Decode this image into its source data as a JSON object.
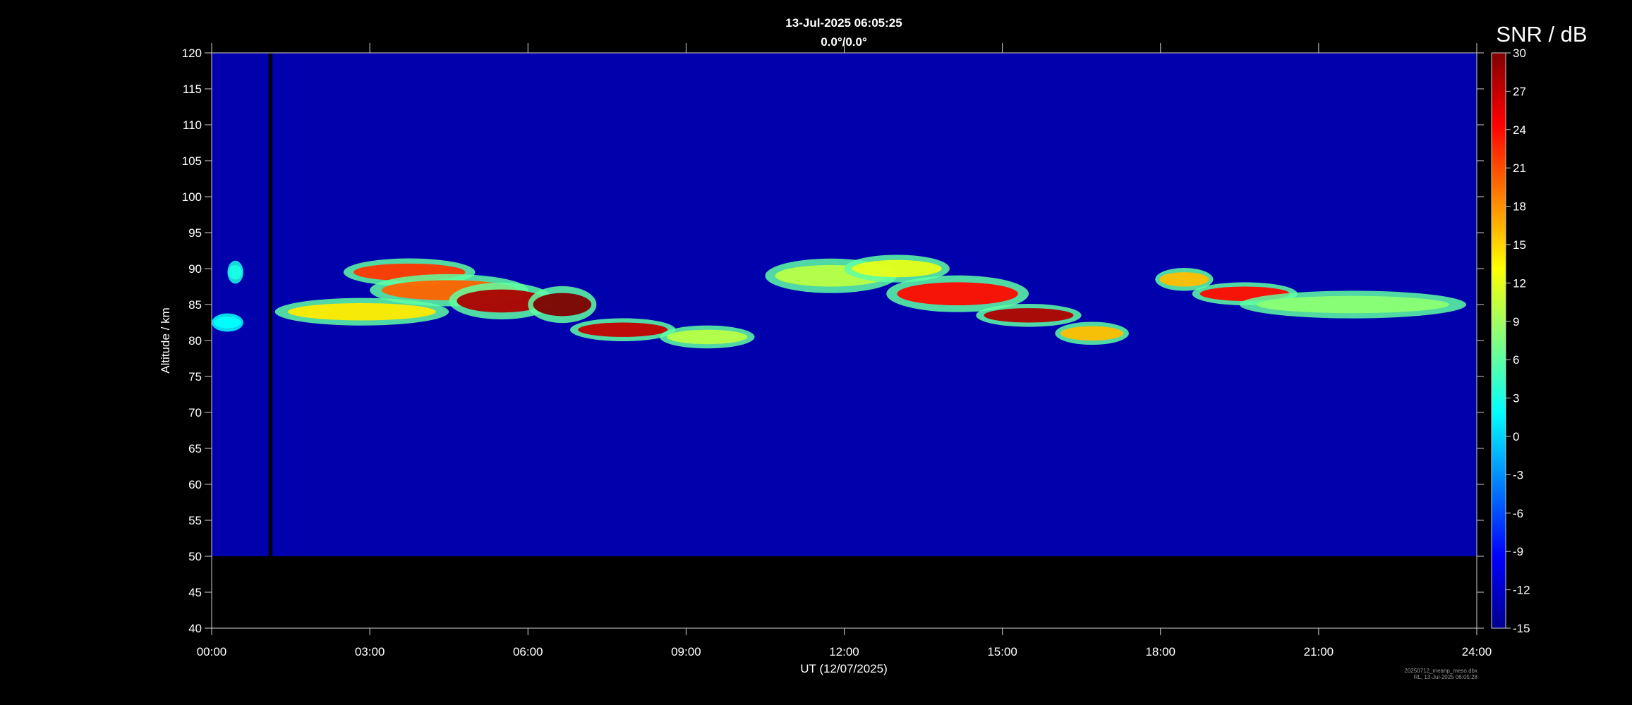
{
  "chart_data": {
    "type": "heatmap",
    "title": "13-Jul-2025 06:05:25",
    "subtitle": "0.0°/0.0°",
    "xlabel": "UT (12/07/2025)",
    "ylabel": "Altitude / km",
    "colorbar_label": "SNR / dB",
    "x_ticks": [
      "00:00",
      "03:00",
      "06:00",
      "09:00",
      "12:00",
      "15:00",
      "18:00",
      "21:00",
      "24:00"
    ],
    "x_range_hours": [
      0,
      24
    ],
    "ylim": [
      40,
      120
    ],
    "y_ticks": [
      40,
      45,
      50,
      55,
      60,
      65,
      70,
      75,
      80,
      85,
      90,
      95,
      100,
      105,
      110,
      115,
      120
    ],
    "colorbar_range": [
      -15,
      30
    ],
    "colorbar_ticks": [
      -15,
      -12,
      -9,
      -6,
      -3,
      0,
      3,
      6,
      9,
      12,
      15,
      18,
      21,
      24,
      27,
      30
    ],
    "colormap": "jet",
    "data_altitude_range": [
      50,
      120
    ],
    "background_snr": -13,
    "data_gap": {
      "start_hour": 1.08,
      "end_hour": 1.15
    },
    "echo_features": [
      {
        "t0": 0.0,
        "t1": 0.6,
        "alt": 82.5,
        "width": 0.8,
        "snr": 2
      },
      {
        "t0": 0.3,
        "t1": 0.6,
        "alt": 89.5,
        "width": 1.0,
        "snr": 3
      },
      {
        "t0": 1.2,
        "t1": 4.5,
        "alt": 84.0,
        "width": 1.2,
        "snr": 14
      },
      {
        "t0": 2.5,
        "t1": 5.0,
        "alt": 89.5,
        "width": 1.2,
        "snr": 22
      },
      {
        "t0": 3.0,
        "t1": 6.0,
        "alt": 87.0,
        "width": 1.4,
        "snr": 20
      },
      {
        "t0": 4.5,
        "t1": 6.5,
        "alt": 85.5,
        "width": 1.6,
        "snr": 28
      },
      {
        "t0": 6.0,
        "t1": 7.3,
        "alt": 85.0,
        "width": 1.6,
        "snr": 30
      },
      {
        "t0": 6.8,
        "t1": 8.8,
        "alt": 81.5,
        "width": 1.0,
        "snr": 27
      },
      {
        "t0": 8.5,
        "t1": 10.3,
        "alt": 80.5,
        "width": 1.0,
        "snr": 10
      },
      {
        "t0": 10.5,
        "t1": 13.0,
        "alt": 89.0,
        "width": 1.5,
        "snr": 10
      },
      {
        "t0": 12.0,
        "t1": 14.0,
        "alt": 90.0,
        "width": 1.2,
        "snr": 12
      },
      {
        "t0": 12.8,
        "t1": 15.5,
        "alt": 86.5,
        "width": 1.6,
        "snr": 24
      },
      {
        "t0": 14.5,
        "t1": 16.5,
        "alt": 83.5,
        "width": 1.0,
        "snr": 28
      },
      {
        "t0": 16.0,
        "t1": 17.4,
        "alt": 81.0,
        "width": 1.0,
        "snr": 16
      },
      {
        "t0": 17.9,
        "t1": 19.0,
        "alt": 88.5,
        "width": 1.0,
        "snr": 16
      },
      {
        "t0": 18.6,
        "t1": 20.6,
        "alt": 86.5,
        "width": 1.0,
        "snr": 24
      },
      {
        "t0": 19.5,
        "t1": 23.8,
        "alt": 85.0,
        "width": 1.2,
        "snr": 8
      }
    ]
  },
  "footer": {
    "line1": "20250712_meanp_meso.dbx",
    "line2": "RL, 13-Jul-2025 06:05:28"
  }
}
